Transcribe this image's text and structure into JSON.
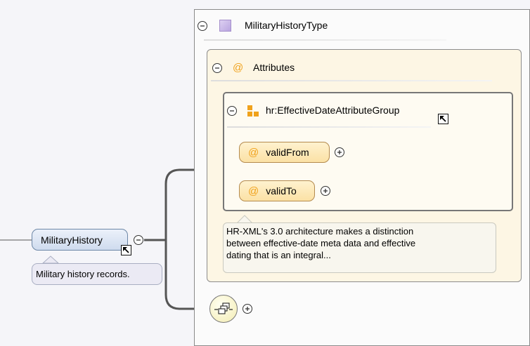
{
  "type_box": {
    "title": "MilitaryHistoryType",
    "type_icon": "complex-type-icon"
  },
  "attributes": {
    "label": "Attributes",
    "icon": "at-sign-icon",
    "symbol": "@"
  },
  "attribute_group": {
    "name": "hr:EffectiveDateAttributeGroup",
    "icon": "attribute-group-icon"
  },
  "attribute_items": [
    {
      "name": "validFrom",
      "symbol": "@"
    },
    {
      "name": "validTo",
      "symbol": "@"
    }
  ],
  "group_annotation": "HR-XML's 3.0 architecture makes a distinction\nbetween effective-date meta data and effective\ndating that is an integral...",
  "root_element": {
    "name": "MilitaryHistory",
    "annotation": "Military history records."
  },
  "sequence": {
    "icon": "sequence-compositor-icon"
  },
  "colors": {
    "canvas": "#f5f5f9",
    "attribute_box": "#fdf6e4",
    "accent_orange": "#f0a21c",
    "element_pill": "#cfdbee",
    "connector": "#555555"
  }
}
